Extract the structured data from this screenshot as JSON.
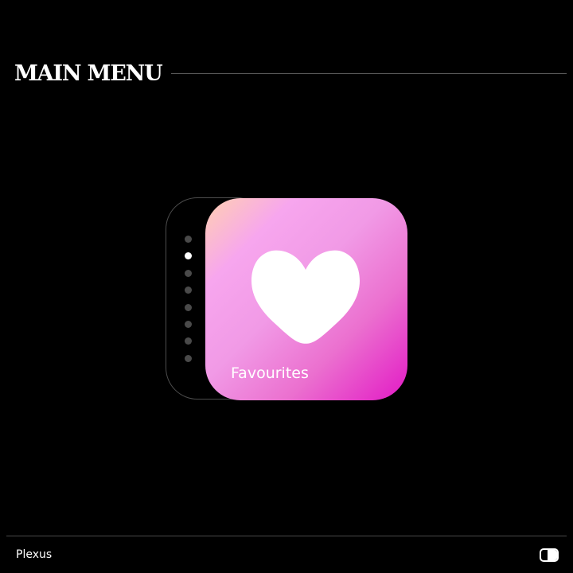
{
  "header": {
    "title": "MAIN MENU"
  },
  "menu": {
    "page_indicator": {
      "total": 8,
      "active_index": 1
    },
    "selected_item": {
      "label": "Favourites",
      "icon": "heart-icon",
      "gradient_colors": [
        "#ffd0b0",
        "#f7a6ee",
        "#eb70cf",
        "#e21ac5"
      ]
    }
  },
  "footer": {
    "brand": "Plexus",
    "toggle_icon": "toggle-switch-icon"
  },
  "colors": {
    "background": "#000000",
    "text": "#ffffff",
    "divider": "#5a5a5a",
    "dot_inactive": "#4a4a4a",
    "dot_active": "#ffffff"
  }
}
